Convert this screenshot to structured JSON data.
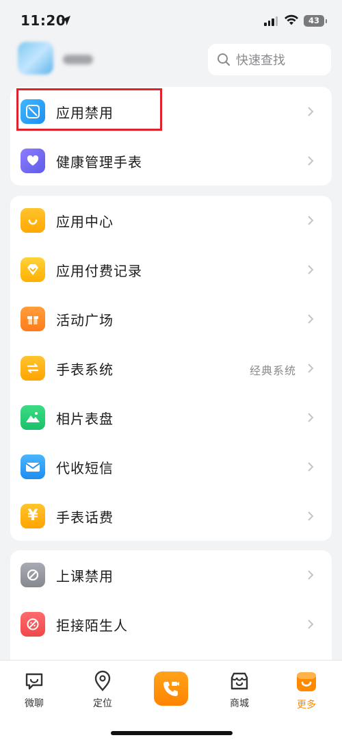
{
  "status_bar": {
    "time": "11:20",
    "battery": "43"
  },
  "header": {
    "search_placeholder": "快速查找"
  },
  "cards": [
    {
      "items": [
        {
          "label": "应用禁用",
          "icon": "app-block-icon"
        },
        {
          "label": "健康管理手表",
          "icon": "health-watch-icon"
        }
      ]
    },
    {
      "items": [
        {
          "label": "应用中心",
          "icon": "app-store-bag-icon"
        },
        {
          "label": "应用付费记录",
          "icon": "diamond-icon"
        },
        {
          "label": "活动广场",
          "icon": "gift-box-icon"
        },
        {
          "label": "手表系统",
          "icon": "swap-arrows-icon",
          "value": "经典系统"
        },
        {
          "label": "相片表盘",
          "icon": "photo-mountain-icon"
        },
        {
          "label": "代收短信",
          "icon": "envelope-icon"
        },
        {
          "label": "手表话费",
          "icon": "yuan-icon"
        }
      ]
    },
    {
      "items": [
        {
          "label": "上课禁用",
          "icon": "class-block-icon"
        },
        {
          "label": "拒接陌生人",
          "icon": "reject-stranger-icon"
        }
      ]
    }
  ],
  "tabbar": {
    "items": [
      {
        "label": "微聊",
        "icon": "chat-icon",
        "active": false
      },
      {
        "label": "定位",
        "icon": "location-pin-icon",
        "active": false
      },
      {
        "label": "",
        "icon": "video-call-icon",
        "active": false
      },
      {
        "label": "商城",
        "icon": "shop-icon",
        "active": false
      },
      {
        "label": "更多",
        "icon": "more-icon",
        "active": true
      }
    ]
  },
  "colors": {
    "accent": "#ff8a00",
    "highlight": "#e0202a"
  }
}
